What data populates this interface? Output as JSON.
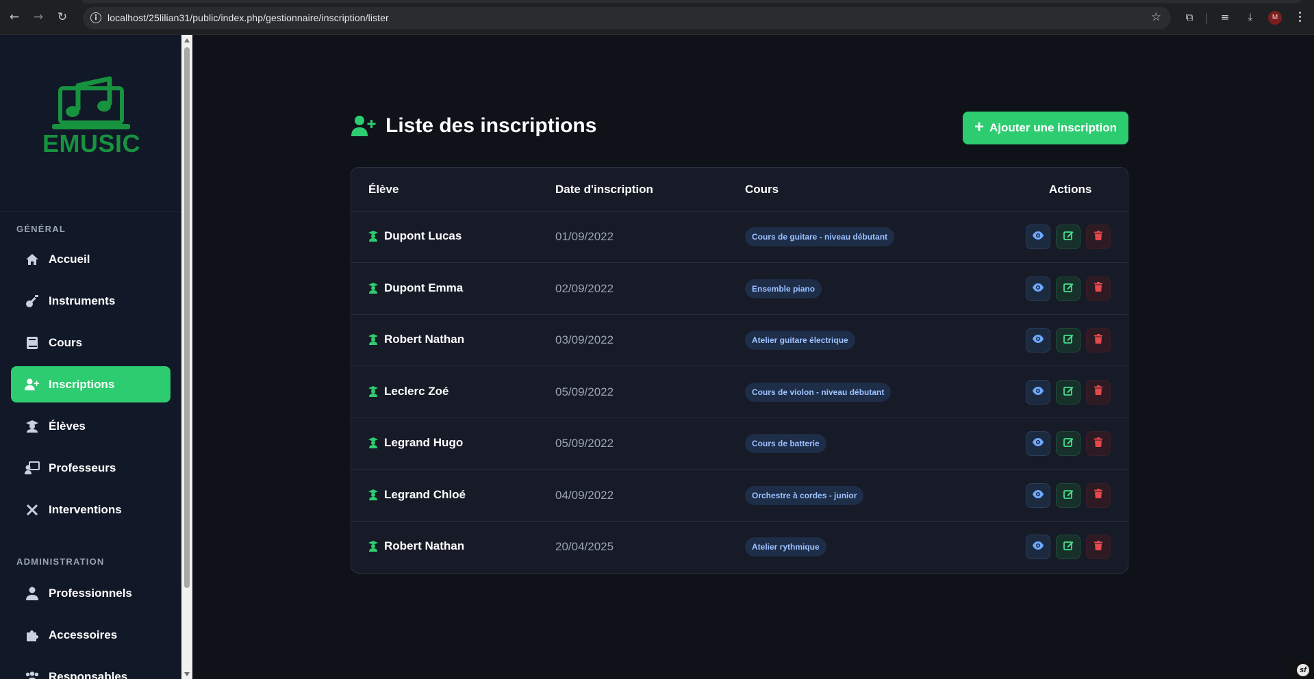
{
  "browser": {
    "url": "localhost/25lilian31/public/index.php/gestionnaire/inscription/lister",
    "profile_initial": "M"
  },
  "sidebar": {
    "logo_text": "EMUSIC",
    "sections": [
      {
        "title": "GÉNÉRAL",
        "items": [
          {
            "label": "Accueil",
            "icon": "home-icon"
          },
          {
            "label": "Instruments",
            "icon": "guitar-icon"
          },
          {
            "label": "Cours",
            "icon": "book-icon"
          },
          {
            "label": "Inscriptions",
            "icon": "user-plus-icon",
            "active": true
          },
          {
            "label": "Élèves",
            "icon": "graduate-icon"
          },
          {
            "label": "Professeurs",
            "icon": "teacher-icon"
          },
          {
            "label": "Interventions",
            "icon": "tools-icon"
          }
        ]
      },
      {
        "title": "ADMINISTRATION",
        "items": [
          {
            "label": "Professionnels",
            "icon": "user-tie-icon"
          },
          {
            "label": "Accessoires",
            "icon": "puzzle-icon"
          },
          {
            "label": "Responsables",
            "icon": "users-icon"
          }
        ]
      }
    ]
  },
  "page": {
    "title": "Liste des inscriptions",
    "add_button": "Ajouter une inscription"
  },
  "table": {
    "headers": [
      "Élève",
      "Date d'inscription",
      "Cours",
      "Actions"
    ],
    "rows": [
      {
        "eleve": "Dupont Lucas",
        "date": "01/09/2022",
        "cours": "Cours de guitare - niveau débutant"
      },
      {
        "eleve": "Dupont Emma",
        "date": "02/09/2022",
        "cours": "Ensemble piano"
      },
      {
        "eleve": "Robert Nathan",
        "date": "03/09/2022",
        "cours": "Atelier guitare électrique"
      },
      {
        "eleve": "Leclerc Zoé",
        "date": "05/09/2022",
        "cours": "Cours de violon - niveau débutant"
      },
      {
        "eleve": "Legrand Hugo",
        "date": "05/09/2022",
        "cours": "Cours de batterie"
      },
      {
        "eleve": "Legrand Chloé",
        "date": "04/09/2022",
        "cours": "Orchestre à cordes - junior"
      },
      {
        "eleve": "Robert Nathan",
        "date": "20/04/2025",
        "cours": "Atelier rythmique"
      }
    ]
  },
  "colors": {
    "accent": "#2ecc71",
    "sidebar_bg": "#111827",
    "main_bg": "#0f1219",
    "badge_bg": "#1e2d48",
    "badge_text": "#9cc2ff",
    "danger": "#e5484d"
  }
}
